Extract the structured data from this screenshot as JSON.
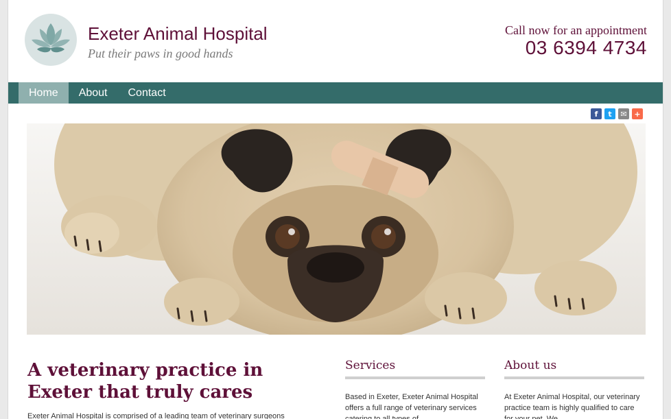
{
  "header": {
    "site_title": "Exeter Animal Hospital",
    "tagline": "Put their paws in good hands",
    "call_label": "Call now for an appointment",
    "phone": "03 6394 4734"
  },
  "nav": {
    "items": [
      {
        "label": "Home",
        "active": true
      },
      {
        "label": "About",
        "active": false
      },
      {
        "label": "Contact",
        "active": false
      }
    ]
  },
  "share": {
    "buttons": [
      {
        "name": "facebook-icon",
        "glyph": "f",
        "color": "#3b5998"
      },
      {
        "name": "twitter-icon",
        "glyph": "t",
        "color": "#1da1f2"
      },
      {
        "name": "email-icon",
        "glyph": "✉",
        "color": "#888888"
      },
      {
        "name": "more-icon",
        "glyph": "+",
        "color": "#f96a4a"
      }
    ]
  },
  "main": {
    "heading": "A veterinary practice in Exeter that truly cares",
    "intro": "Exeter Animal Hospital is comprised of a leading team of veterinary surgeons"
  },
  "services": {
    "title": "Services",
    "text": "Based in Exeter, Exeter Animal Hospital offers a full range of veterinary services catering to all types of"
  },
  "about": {
    "title": "About us",
    "text": "At Exeter Animal Hospital, our veterinary practice team is highly qualified to care for your pet. We"
  },
  "colors": {
    "brand": "#5e1038",
    "nav": "#346c6a",
    "nav_active": "#8fb0ae"
  }
}
